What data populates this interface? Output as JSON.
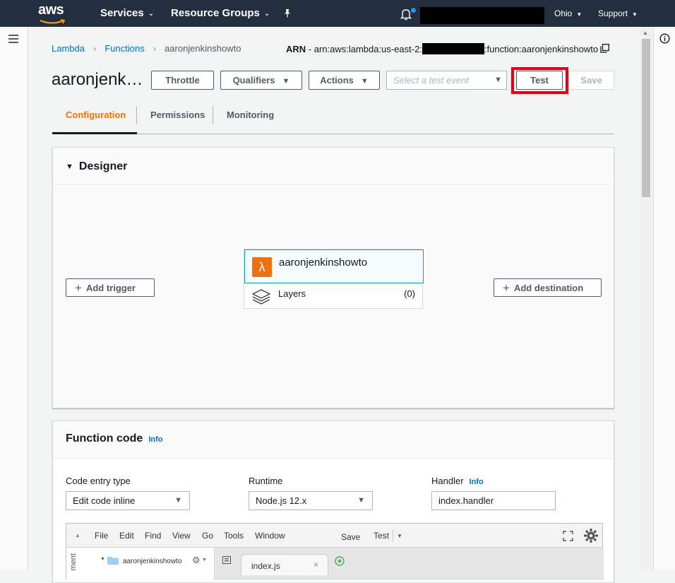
{
  "topnav": {
    "logo": "aws",
    "services": "Services",
    "resource_groups": "Resource Groups",
    "region": "Ohio",
    "support": "Support"
  },
  "breadcrumb": {
    "lambda": "Lambda",
    "functions": "Functions",
    "current": "aaronjenkinshowto"
  },
  "arn": {
    "label": "ARN",
    "prefix": " - arn:aws:lambda:us-east-2:",
    "suffix": ":function:aaronjenkinshowto"
  },
  "header": {
    "function_name": "aaronjenk…",
    "throttle": "Throttle",
    "qualifiers": "Qualifiers",
    "actions": "Actions",
    "test_event_placeholder": "Select a test event",
    "test": "Test",
    "save": "Save"
  },
  "tabs": {
    "configuration": "Configuration",
    "permissions": "Permissions",
    "monitoring": "Monitoring"
  },
  "designer": {
    "title": "Designer",
    "function_name": "aaronjenkinshowto",
    "layers_label": "Layers",
    "layers_count": "(0)",
    "add_trigger": "Add trigger",
    "add_destination": "Add destination"
  },
  "function_code": {
    "title": "Function code",
    "info": "Info",
    "code_entry_label": "Code entry type",
    "code_entry_value": "Edit code inline",
    "runtime_label": "Runtime",
    "runtime_value": "Node.js 12.x",
    "handler_label": "Handler",
    "handler_info": "Info",
    "handler_value": "index.handler"
  },
  "editor": {
    "menu": [
      "File",
      "Edit",
      "Find",
      "View",
      "Go",
      "Tools",
      "Window"
    ],
    "save": "Save",
    "test": "Test",
    "side_label": "ment",
    "folder": "aaronjenkinshowto",
    "tab_file": "index.js"
  },
  "colors": {
    "nav_bg": "#232f3e",
    "accent_orange": "#ec7211",
    "link_blue": "#0073bb",
    "highlight_red": "#e3001b"
  }
}
